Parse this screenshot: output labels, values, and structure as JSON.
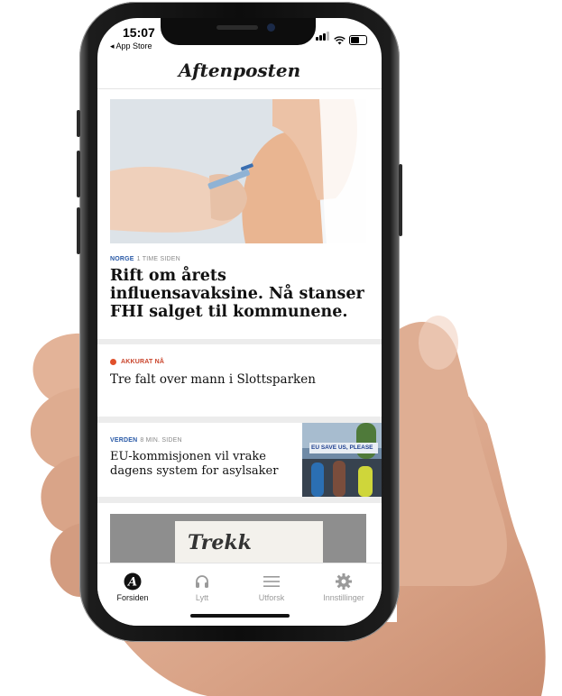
{
  "status_bar": {
    "time": "15:07",
    "back_app": "◂ App Store"
  },
  "header": {
    "logo": "Aftenposten"
  },
  "articles": [
    {
      "section": "NORGE",
      "age": "1 TIME SIDEN",
      "headline": "Rift om årets influensavaksine. Nå stanser FHI salget til kommunene."
    },
    {
      "live_label": "AKKURAT NÅ",
      "headline": "Tre falt over mann i Slottsparken"
    },
    {
      "section": "VERDEN",
      "age": "8 MIN. SIDEN",
      "headline": "EU-kommisjonen vil vrake dagens system for asylsaker",
      "image_sign": "EU  SAVE US, PLEASE"
    },
    {
      "image_text": "Trekk"
    }
  ],
  "tabbar": [
    {
      "label": "Forsiden",
      "icon": "aftenposten-logo-icon",
      "active": true
    },
    {
      "label": "Lytt",
      "icon": "headphones-icon",
      "active": false
    },
    {
      "label": "Utforsk",
      "icon": "menu-icon",
      "active": false
    },
    {
      "label": "Innstillinger",
      "icon": "gear-icon",
      "active": false
    }
  ],
  "colors": {
    "section": "#2a5aa7",
    "live": "#e0502b",
    "active_tab": "#111111",
    "inactive_tab": "#9a9a9a"
  }
}
